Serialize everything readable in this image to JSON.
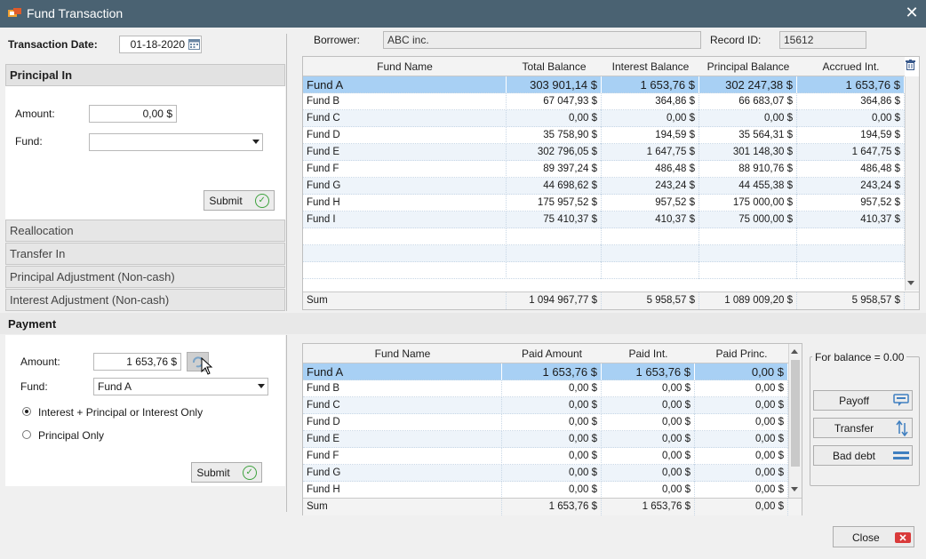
{
  "window": {
    "title": "Fund Transaction",
    "close_glyph": "✕"
  },
  "header": {
    "transaction_date_label": "Transaction Date:",
    "transaction_date_value": "01-18-2020",
    "borrower_label": "Borrower:",
    "borrower_value": "ABC inc.",
    "record_id_label": "Record ID:",
    "record_id_value": "15612"
  },
  "principal_in": {
    "title": "Principal In",
    "amount_label": "Amount:",
    "amount_value": "0,00 $",
    "fund_label": "Fund:",
    "fund_value": "",
    "submit_label": "Submit"
  },
  "accordion": {
    "reallocation": "Reallocation",
    "transfer_in": "Transfer In",
    "principal_adjustment": "Principal Adjustment (Non-cash)",
    "interest_adjustment": "Interest Adjustment (Non-cash)"
  },
  "payment": {
    "title": "Payment",
    "amount_label": "Amount:",
    "amount_value": "1 653,76 $",
    "fund_label": "Fund:",
    "fund_value": "Fund A",
    "radio_1": "Interest + Principal or Interest Only",
    "radio_2": "Principal Only",
    "selected_radio": 1,
    "submit_label": "Submit"
  },
  "balance_table": {
    "columns": [
      "Fund Name",
      "Total Balance",
      "Interest Balance",
      "Principal Balance",
      "Accrued Int."
    ],
    "rows": [
      [
        "Fund A",
        "303 901,14 $",
        "1 653,76 $",
        "302 247,38 $",
        "1 653,76 $"
      ],
      [
        "Fund B",
        "67 047,93 $",
        "364,86 $",
        "66 683,07 $",
        "364,86 $"
      ],
      [
        "Fund C",
        "0,00 $",
        "0,00 $",
        "0,00 $",
        "0,00 $"
      ],
      [
        "Fund D",
        "35 758,90 $",
        "194,59 $",
        "35 564,31 $",
        "194,59 $"
      ],
      [
        "Fund E",
        "302 796,05 $",
        "1 647,75 $",
        "301 148,30 $",
        "1 647,75 $"
      ],
      [
        "Fund F",
        "89 397,24 $",
        "486,48 $",
        "88 910,76 $",
        "486,48 $"
      ],
      [
        "Fund G",
        "44 698,62 $",
        "243,24 $",
        "44 455,38 $",
        "243,24 $"
      ],
      [
        "Fund H",
        "175 957,52 $",
        "957,52 $",
        "175 000,00 $",
        "957,52 $"
      ],
      [
        "Fund I",
        "75 410,37 $",
        "410,37 $",
        "75 000,00 $",
        "410,37 $"
      ]
    ],
    "sum": [
      "Sum",
      "1 094 967,77 $",
      "5 958,57 $",
      "1 089 009,20 $",
      "5 958,57 $"
    ]
  },
  "payment_table": {
    "columns": [
      "Fund Name",
      "Paid Amount",
      "Paid Int.",
      "Paid Princ."
    ],
    "rows": [
      [
        "Fund A",
        "1 653,76 $",
        "1 653,76 $",
        "0,00 $"
      ],
      [
        "Fund B",
        "0,00 $",
        "0,00 $",
        "0,00 $"
      ],
      [
        "Fund C",
        "0,00 $",
        "0,00 $",
        "0,00 $"
      ],
      [
        "Fund D",
        "0,00 $",
        "0,00 $",
        "0,00 $"
      ],
      [
        "Fund E",
        "0,00 $",
        "0,00 $",
        "0,00 $"
      ],
      [
        "Fund F",
        "0,00 $",
        "0,00 $",
        "0,00 $"
      ],
      [
        "Fund G",
        "0,00 $",
        "0,00 $",
        "0,00 $"
      ],
      [
        "Fund H",
        "0,00 $",
        "0,00 $",
        "0,00 $"
      ]
    ],
    "sum": [
      "Sum",
      "1 653,76 $",
      "1 653,76 $",
      "0,00 $"
    ]
  },
  "balance_box": {
    "legend": "For balance = 0.00",
    "payoff": "Payoff",
    "transfer": "Transfer",
    "bad_debt": "Bad debt"
  },
  "footer": {
    "close_label": "Close"
  },
  "colors": {
    "titlebar": "#4a6272",
    "selected_row": "#a8d0f4",
    "accent_green": "#3da23d",
    "close_red": "#d93a3a"
  },
  "icons": [
    "app-icon",
    "calendar-icon",
    "delete-icon",
    "refresh-icon",
    "check-icon",
    "payoff-icon",
    "transfer-icon",
    "bad-debt-icon",
    "close-x-icon",
    "mouse-cursor-icon"
  ]
}
